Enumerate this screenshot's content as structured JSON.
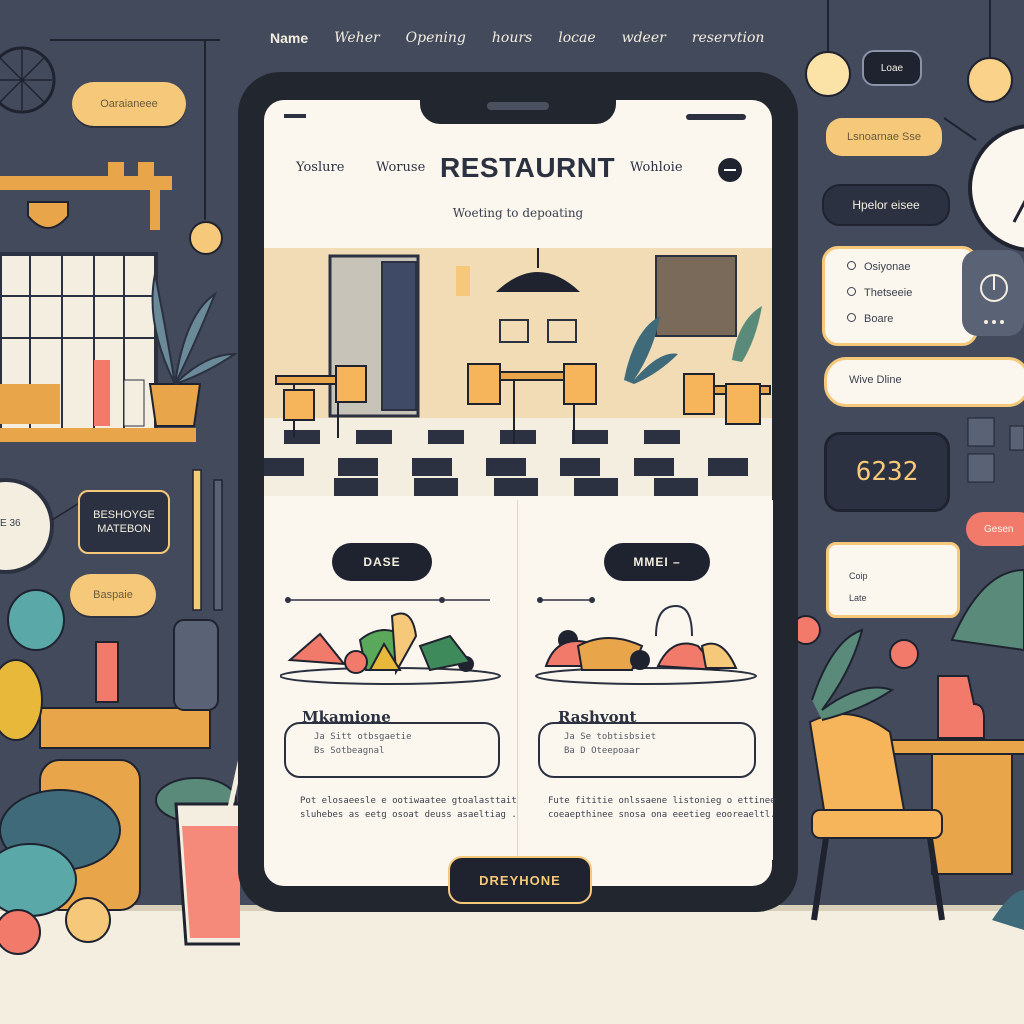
{
  "top_nav": [
    "Name",
    "Weher",
    "Opening",
    "hours",
    "locae",
    "wdeer",
    "reservtion"
  ],
  "left_panel": {
    "pill_top": "Oaraianeee",
    "dark_badge": "BESHOYGE\nMATEBON",
    "pill_bottom": "Baspaie",
    "plate_text": "E 36"
  },
  "app": {
    "nav_left": "Yoslure",
    "nav_mid": "Woruse",
    "title": "RESTAURNT",
    "nav_right": "Wohloie",
    "tagline": "Woeting to depoating"
  },
  "cards": [
    {
      "button": "DASE",
      "title": "Mkamione",
      "lines": [
        "Ja Sitt otbsgaetie",
        "Bs Sotbeagnal"
      ],
      "desc": "Pot elosaeesle e ootiwaatee gtoalasttaitie.\nsluhebes as eetg osoat deuss asaeltiag ..."
    },
    {
      "button": "MMEI –",
      "title": "Rashvont",
      "lines": [
        "Ja Se tobtisbsiet",
        "Ba D Oteepoaar"
      ],
      "desc": "Fute fititie onlssaene listonieg o ettinee\ncoeaepthinee snosa ona eeetieg eooreaeltl."
    }
  ],
  "bottom_button": "DREYHONE",
  "right_panel": {
    "loc_button": "Loae",
    "amber_button": "Lsnoarnae Sse",
    "dark_button": "Hpelor eisee",
    "options": [
      "Osiyonae",
      "Thetseeie",
      "Boare"
    ],
    "field": "Wive Dline",
    "counter": "6232",
    "coral_button": "Gesen",
    "mini": [
      "Coip",
      "Late"
    ]
  }
}
